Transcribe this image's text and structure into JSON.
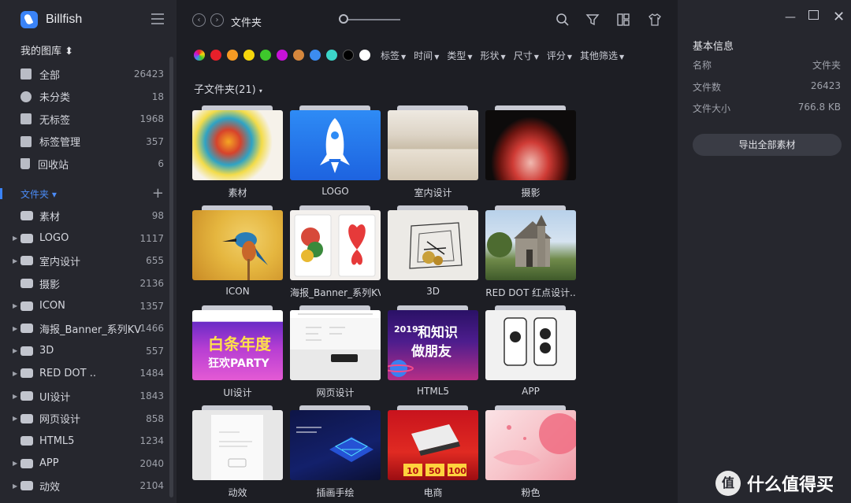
{
  "app": {
    "name": "Billfish"
  },
  "sidebar": {
    "library_title": "我的图库",
    "library_items": [
      {
        "label": "全部",
        "count": "26423",
        "icon": "grid-icon"
      },
      {
        "label": "未分类",
        "count": "18",
        "icon": "pie-icon"
      },
      {
        "label": "无标签",
        "count": "1968",
        "icon": "untagged-icon"
      },
      {
        "label": "标签管理",
        "count": "357",
        "icon": "tag-manage-icon"
      },
      {
        "label": "回收站",
        "count": "6",
        "icon": "trash-icon"
      }
    ],
    "folders_title": "文件夹",
    "folders": [
      {
        "label": "素材",
        "count": "98",
        "expandable": false
      },
      {
        "label": "LOGO",
        "count": "1117",
        "expandable": true
      },
      {
        "label": "室内设计",
        "count": "655",
        "expandable": true
      },
      {
        "label": "摄影",
        "count": "2136",
        "expandable": false
      },
      {
        "label": "ICON",
        "count": "1357",
        "expandable": true
      },
      {
        "label": "海报_Banner_系列KV",
        "count": "1466",
        "expandable": true
      },
      {
        "label": "3D",
        "count": "557",
        "expandable": true
      },
      {
        "label": "RED DOT ..",
        "count": "1484",
        "expandable": true
      },
      {
        "label": "UI设计",
        "count": "1843",
        "expandable": true
      },
      {
        "label": "网页设计",
        "count": "858",
        "expandable": true
      },
      {
        "label": "HTML5",
        "count": "1234",
        "expandable": false
      },
      {
        "label": "APP",
        "count": "2040",
        "expandable": true
      },
      {
        "label": "动效",
        "count": "2104",
        "expandable": true
      }
    ]
  },
  "toolbar": {
    "breadcrumb": "文件夹"
  },
  "filters": {
    "colors": [
      "#f2a33a",
      "#e8202a",
      "#f59a23",
      "#f5d60c",
      "#3ec82c",
      "#c712d8",
      "#d5873d",
      "#3c8cf0",
      "#3cd6c9",
      "#000000",
      "#ffffff"
    ],
    "items": [
      "标签",
      "时间",
      "类型",
      "形状",
      "尺寸",
      "评分",
      "其他筛选"
    ]
  },
  "main": {
    "subfolder_title": "子文件夹(21)",
    "cards": [
      {
        "name": "素材"
      },
      {
        "name": "LOGO"
      },
      {
        "name": "室内设计"
      },
      {
        "name": "摄影"
      },
      {
        "name": "ICON"
      },
      {
        "name": "海报_Banner_系列KV"
      },
      {
        "name": "3D"
      },
      {
        "name": "RED DOT 红点设计.."
      },
      {
        "name": "UI设计"
      },
      {
        "name": "网页设计"
      },
      {
        "name": "HTML5"
      },
      {
        "name": "APP"
      },
      {
        "name": "动效"
      },
      {
        "name": "插画手绘"
      },
      {
        "name": "电商"
      },
      {
        "name": "粉色"
      }
    ]
  },
  "panel": {
    "title": "基本信息",
    "rows": [
      {
        "key": "名称",
        "value": "文件夹"
      },
      {
        "key": "文件数",
        "value": "26423"
      },
      {
        "key": "文件大小",
        "value": "766.8 KB"
      }
    ],
    "export_label": "导出全部素材"
  },
  "watermark": {
    "text": "什么值得买"
  }
}
